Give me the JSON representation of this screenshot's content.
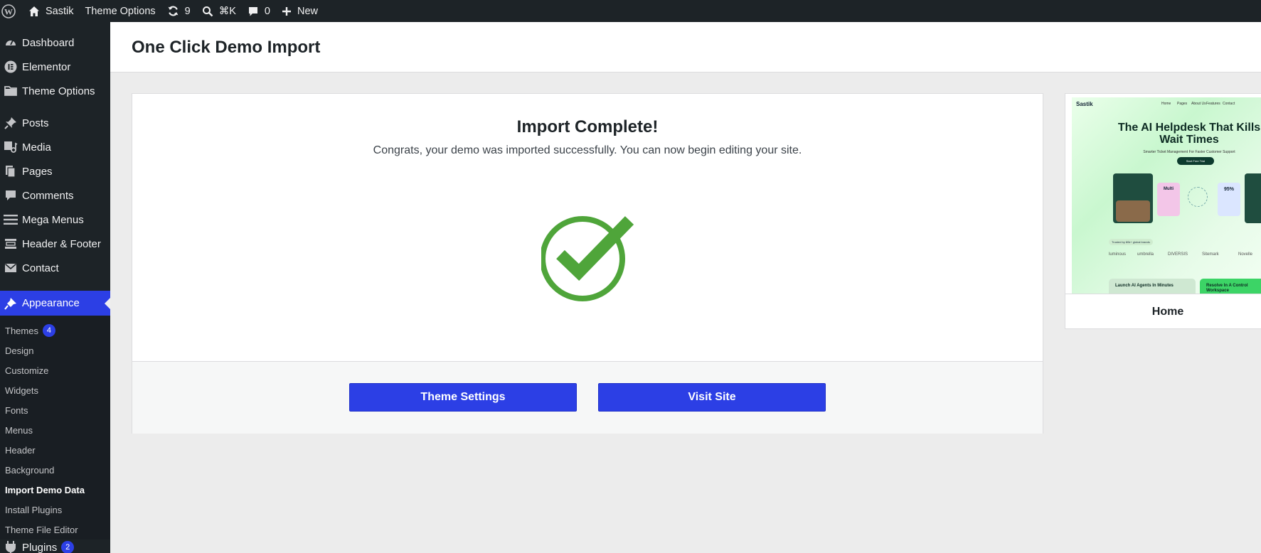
{
  "admin_bar": {
    "site_name": "Sastik",
    "theme_options": "Theme Options",
    "updates_count": "9",
    "search_shortcut": "⌘K",
    "comments_count": "0",
    "new_label": "New"
  },
  "sidebar": {
    "items": [
      {
        "label": "Dashboard",
        "icon": "dashboard-icon"
      },
      {
        "label": "Elementor",
        "icon": "elementor-icon"
      },
      {
        "label": "Theme Options",
        "icon": "folder-icon"
      },
      {
        "label": "Posts",
        "icon": "pin-icon"
      },
      {
        "label": "Media",
        "icon": "media-icon"
      },
      {
        "label": "Pages",
        "icon": "pages-icon"
      },
      {
        "label": "Comments",
        "icon": "comment-icon"
      },
      {
        "label": "Mega Menus",
        "icon": "menu-icon"
      },
      {
        "label": "Header & Footer",
        "icon": "header-footer-icon"
      },
      {
        "label": "Contact",
        "icon": "mail-icon"
      }
    ],
    "current": {
      "label": "Appearance",
      "icon": "brush-icon"
    },
    "submenu": [
      {
        "label": "Themes",
        "badge": "4"
      },
      {
        "label": "Design"
      },
      {
        "label": "Customize"
      },
      {
        "label": "Widgets"
      },
      {
        "label": "Fonts"
      },
      {
        "label": "Menus"
      },
      {
        "label": "Header"
      },
      {
        "label": "Background"
      },
      {
        "label": "Import Demo Data",
        "active": true
      },
      {
        "label": "Install Plugins"
      },
      {
        "label": "Theme File Editor"
      }
    ],
    "next_item": {
      "label": "Plugins",
      "badge": "2"
    }
  },
  "header": {
    "title": "One Click Demo Import"
  },
  "panel": {
    "heading": "Import Complete!",
    "description": "Congrats, your demo was imported successfully. You can now begin editing your site.",
    "success_color": "#4fa53a",
    "buttons": {
      "theme_settings": "Theme Settings",
      "visit_site": "Visit Site"
    }
  },
  "preview": {
    "name": "Home",
    "shot": {
      "logo": "Sastik",
      "nav": [
        "Home",
        "Pages",
        "About Us",
        "Features",
        "Contact"
      ],
      "headline": "The AI Helpdesk That Kills Wait Times",
      "subline": "Smarter Ticket Management For Faster Customer Support",
      "cta": "Start Free Trial",
      "card_text": "Multi",
      "stat": "95%",
      "trust": "Trusted by 80k+ global brands",
      "brands": [
        "luminous",
        "umbrella",
        "DIVERSIS",
        "Sitemark",
        "Novelle"
      ],
      "card1": "Launch AI Agents In Minutes",
      "card2": "Resolve In A Control Workspace"
    }
  },
  "colors": {
    "accent": "#2c3fe5",
    "admin_bg": "#1d2327"
  }
}
